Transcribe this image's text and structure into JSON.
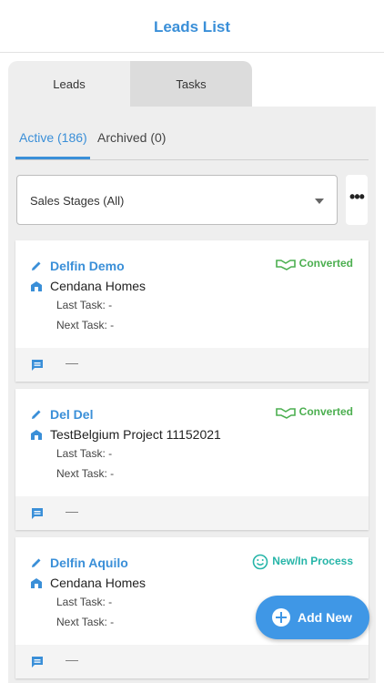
{
  "header": {
    "title": "Leads List"
  },
  "tabs": [
    {
      "label": "Leads"
    },
    {
      "label": "Tasks"
    }
  ],
  "subtabs": {
    "active": "Active (186)",
    "archived": "Archived (0)"
  },
  "filter": {
    "selected": "Sales Stages (All)"
  },
  "more": {
    "label": "•••"
  },
  "card_labels": {
    "last_task": "Last Task:",
    "next_task": "Next Task:",
    "empty_value": "-",
    "footer_dash": "—"
  },
  "leads": [
    {
      "name": "Delfin Demo",
      "project": "Cendana Homes",
      "status": "Converted",
      "last_task": "-",
      "next_task": "-"
    },
    {
      "name": "Del Del",
      "project": "TestBelgium Project 11152021",
      "status": "Converted",
      "last_task": "-",
      "next_task": "-"
    },
    {
      "name": "Delfin Aquilo",
      "project": "Cendana Homes",
      "status": "New/In Process",
      "last_task": "-",
      "next_task": "-"
    }
  ],
  "colors": {
    "accent": "#3a8fd8",
    "converted": "#4caf50",
    "new_in_process": "#26b5a8",
    "fab": "#3f97e6"
  },
  "fab": {
    "label": "Add New"
  }
}
